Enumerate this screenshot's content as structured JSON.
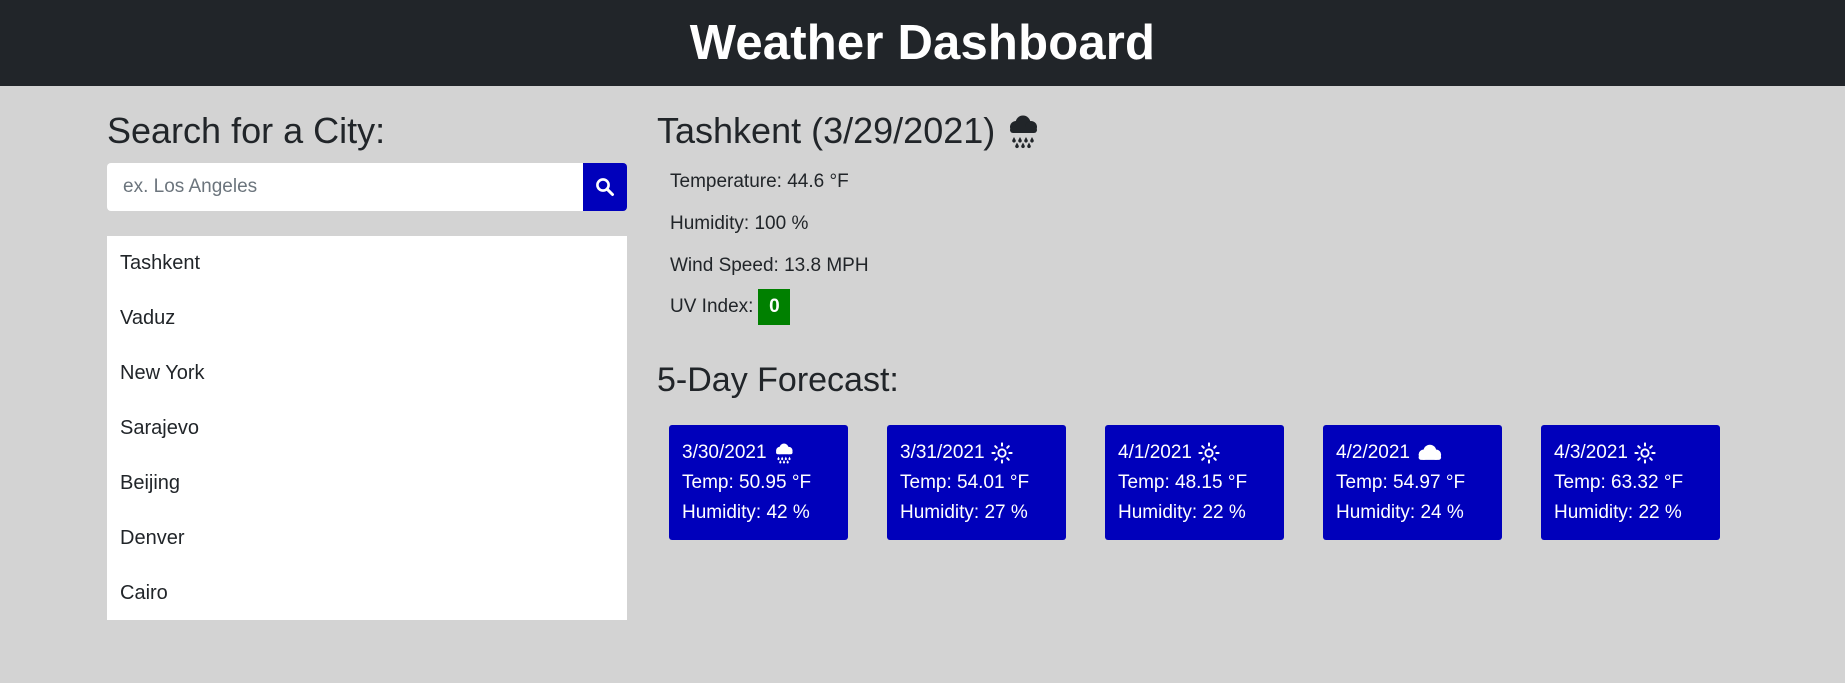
{
  "header": {
    "title": "Weather Dashboard"
  },
  "search": {
    "heading": "Search for a City:",
    "placeholder": "ex. Los Angeles",
    "value": "",
    "button_icon": "search-icon"
  },
  "history": [
    "Tashkent",
    "Vaduz",
    "New York",
    "Sarajevo",
    "Beijing",
    "Denver",
    "Cairo"
  ],
  "current": {
    "city": "Tashkent",
    "date": "(3/29/2021)",
    "icon": "rain-cloud-icon",
    "temperature_label": "Temperature: 44.6 °F",
    "humidity_label": "Humidity: 100 %",
    "wind_label": "Wind Speed: 13.8 MPH",
    "uv_label": "UV Index:",
    "uv_value": "0",
    "uv_color": "#008000"
  },
  "forecast": {
    "heading": "5-Day Forecast:",
    "days": [
      {
        "date": "3/30/2021",
        "icon": "rain-cloud-icon",
        "temp": "Temp: 50.95 °F",
        "humidity": "Humidity: 42 %"
      },
      {
        "date": "3/31/2021",
        "icon": "sun-icon",
        "temp": "Temp: 54.01 °F",
        "humidity": "Humidity: 27 %"
      },
      {
        "date": "4/1/2021",
        "icon": "sun-icon",
        "temp": "Temp: 48.15 °F",
        "humidity": "Humidity: 22 %"
      },
      {
        "date": "4/2/2021",
        "icon": "cloud-icon",
        "temp": "Temp: 54.97 °F",
        "humidity": "Humidity: 24 %"
      },
      {
        "date": "4/3/2021",
        "icon": "sun-icon",
        "temp": "Temp: 63.32 °F",
        "humidity": "Humidity: 22 %"
      }
    ]
  },
  "colors": {
    "header_bg": "#212529",
    "page_bg": "#d3d3d3",
    "accent": "#0000bb",
    "uv_low": "#008000"
  }
}
